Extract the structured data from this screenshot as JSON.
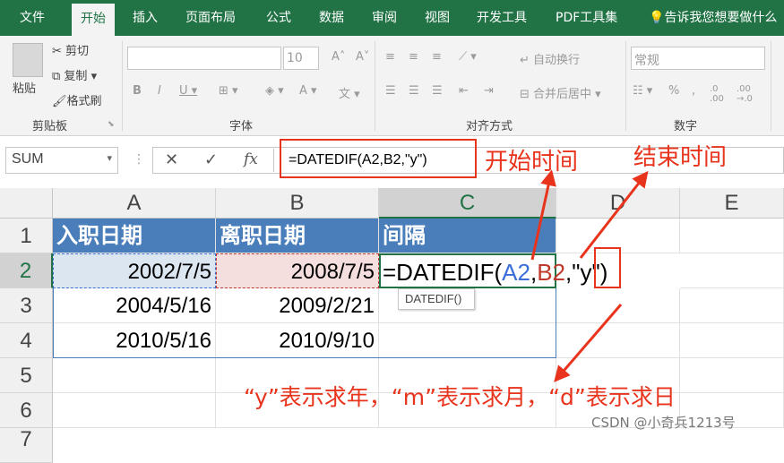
{
  "menu": {
    "tabs": [
      "文件",
      "开始",
      "插入",
      "页面布局",
      "公式",
      "数据",
      "审阅",
      "视图",
      "开发工具",
      "PDF工具集"
    ],
    "tell_me": "告诉我您想要做什么"
  },
  "ribbon": {
    "clipboard": {
      "paste": "粘贴",
      "cut": "剪切",
      "copy": "复制",
      "format_painter": "格式刷",
      "label": "剪贴板"
    },
    "font": {
      "size": "10",
      "label": "字体"
    },
    "alignment": {
      "wrap": "自动换行",
      "merge": "合并后居中",
      "label": "对齐方式"
    },
    "number": {
      "format": "常规",
      "label": "数字"
    }
  },
  "formula_bar": {
    "name_box": "SUM",
    "fx": "fx",
    "formula": "=DATEDIF(A2,B2,\"y\")"
  },
  "columns": [
    "A",
    "B",
    "C",
    "D",
    "E"
  ],
  "rows": [
    "1",
    "2",
    "3",
    "4",
    "5",
    "6",
    "7"
  ],
  "cells": {
    "headers": [
      "入职日期",
      "离职日期",
      "间隔"
    ],
    "data": [
      [
        "2002/7/5",
        "2008/7/5"
      ],
      [
        "2004/5/16",
        "2009/2/21"
      ],
      [
        "2010/5/16",
        "2010/9/10"
      ]
    ]
  },
  "editing": {
    "prefix": "=DATEDIF(",
    "ref_a": "A2",
    "comma1": ",",
    "ref_b": "B2",
    "comma2": ",",
    "arg": "\"y\"",
    "close": ")",
    "tooltip": "DATEDIF()"
  },
  "annotations": {
    "start_time": "开始时间",
    "end_time": "结束时间",
    "explain": "“y”表示求年，“m”表示求月，“d”表示求日",
    "watermark": "CSDN @小奇兵1213号"
  },
  "colors": {
    "excel_green": "#217346",
    "annotation_red": "#e8341c",
    "ref_blue": "#3a6fd8",
    "ref_red": "#c0392b"
  }
}
